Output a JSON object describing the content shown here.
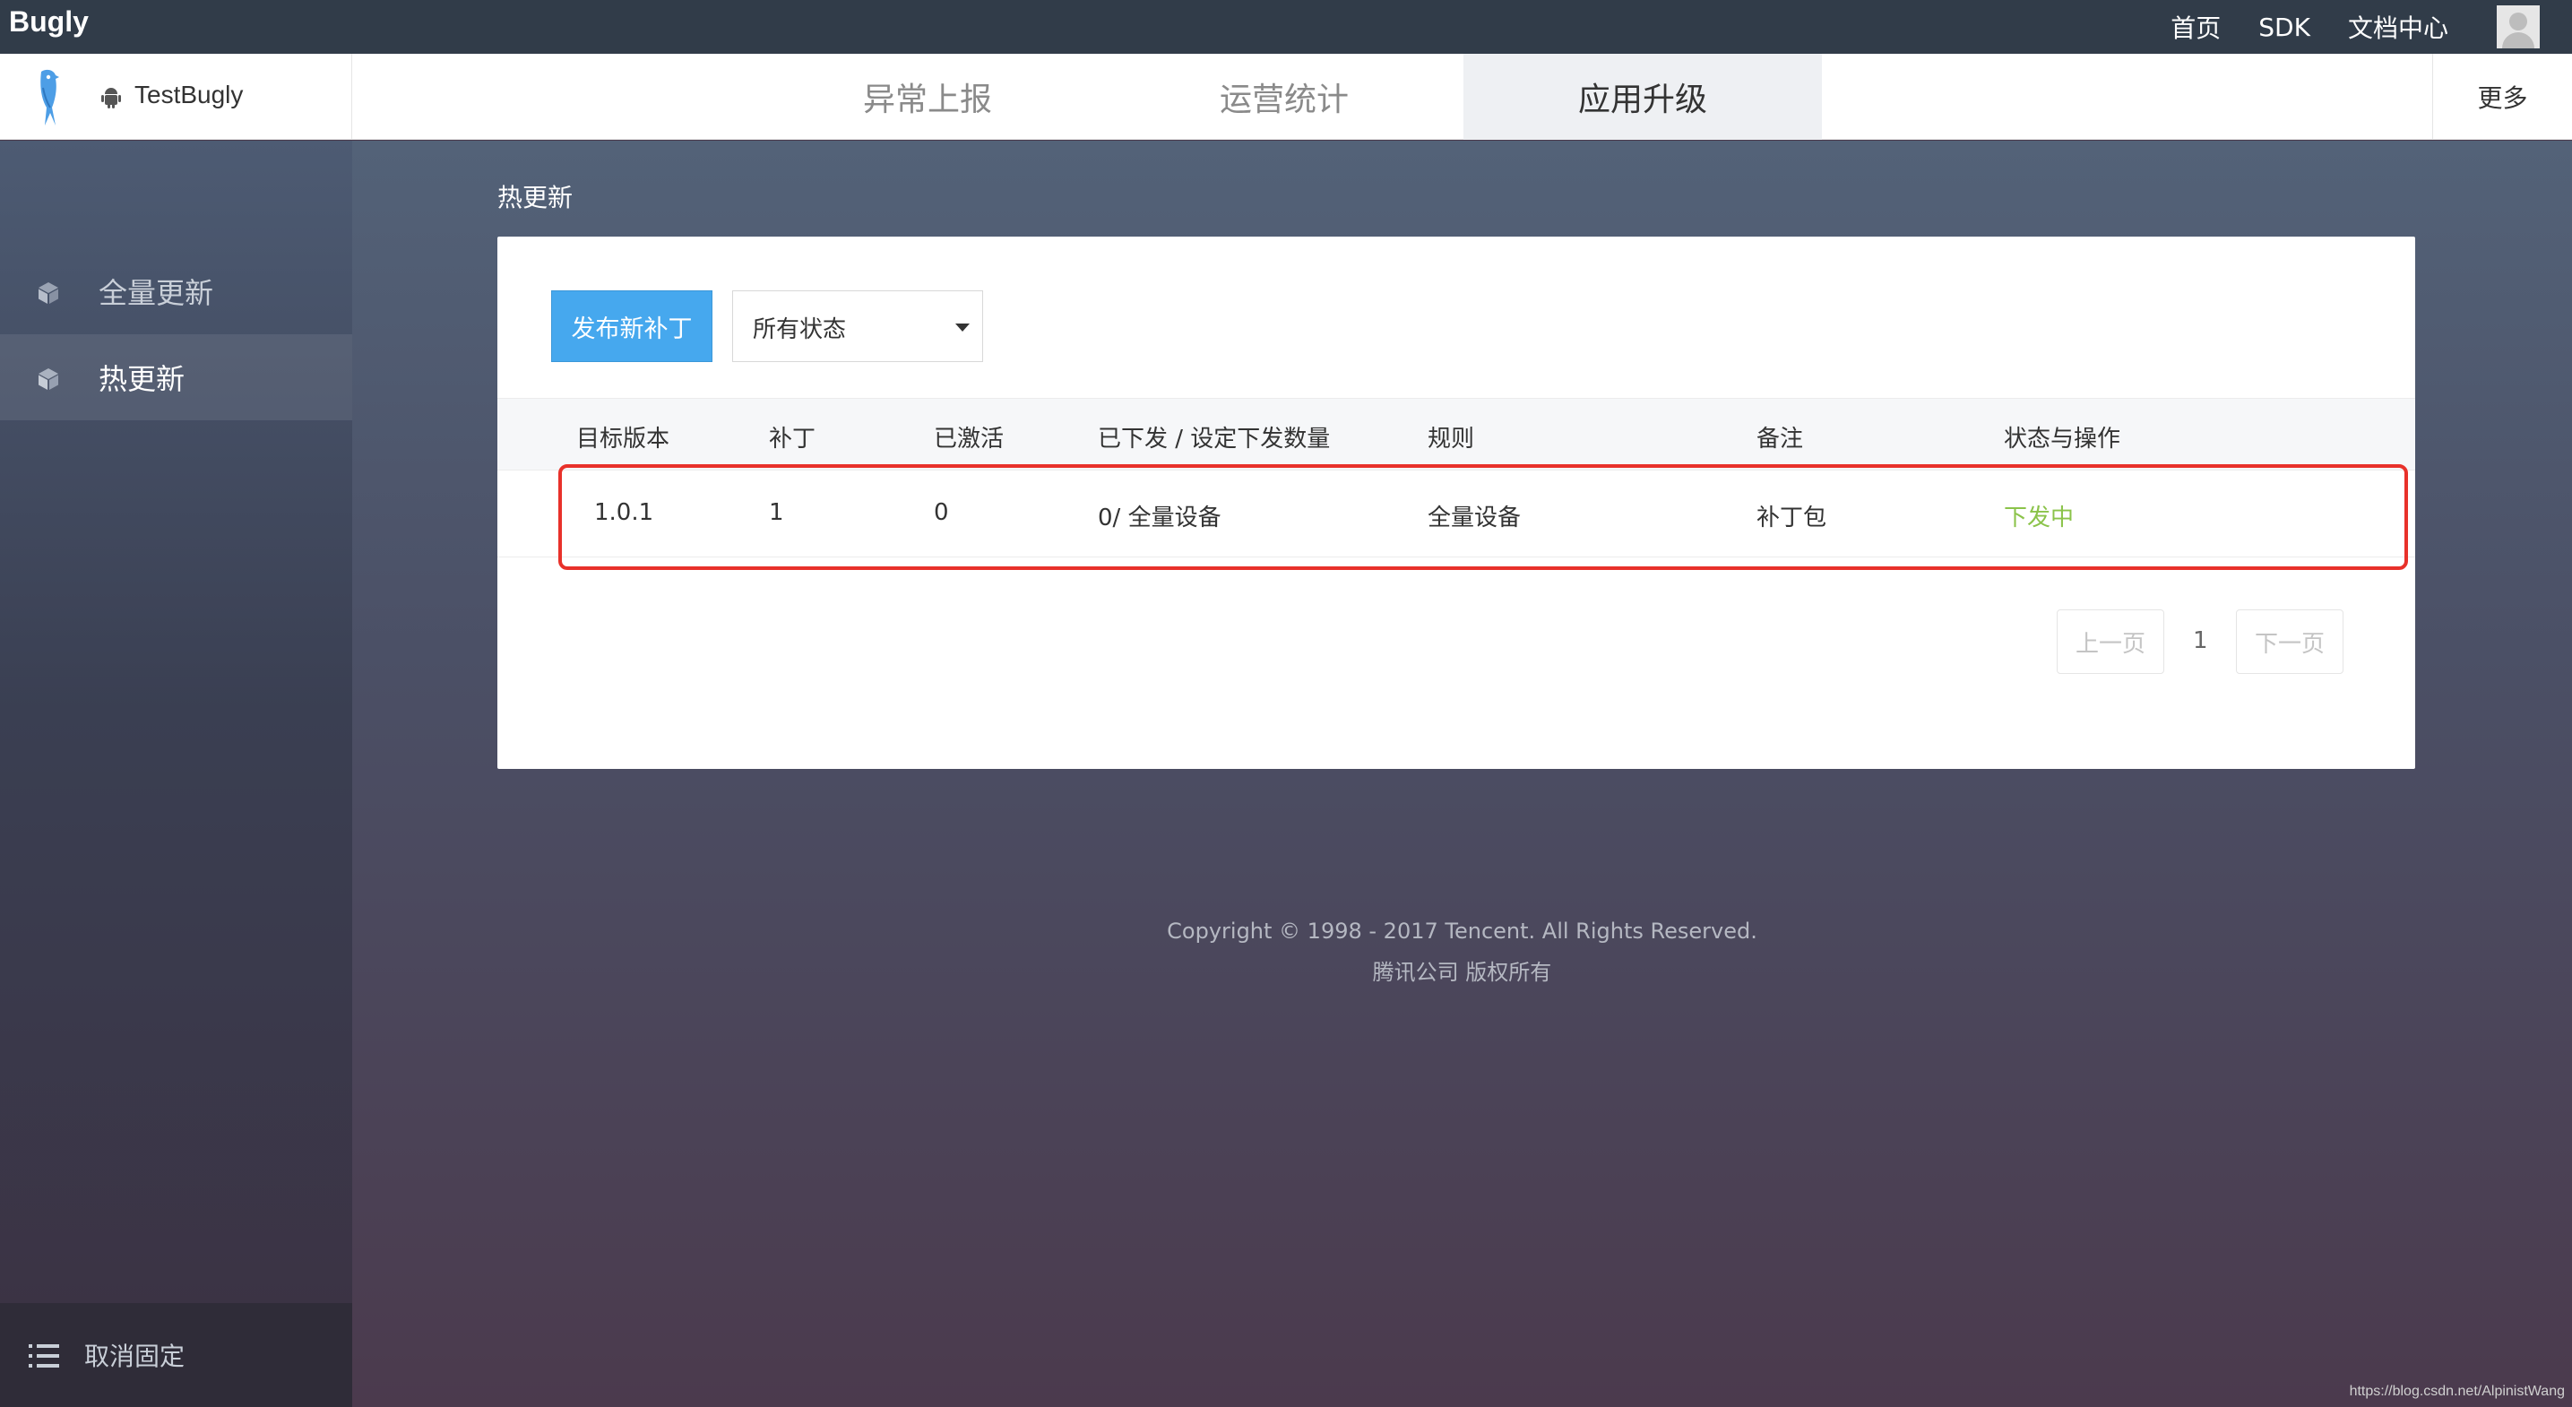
{
  "topbar": {
    "brand": "Bugly",
    "nav": [
      "首页",
      "SDK",
      "文档中心"
    ]
  },
  "appbar": {
    "app_name": "TestBugly",
    "tabs": [
      "异常上报",
      "运营统计",
      "应用升级"
    ],
    "active_tab": "应用升级",
    "more_label": "更多"
  },
  "sidebar": {
    "items": [
      {
        "label": "全量更新",
        "icon": "cube-icon"
      },
      {
        "label": "热更新",
        "icon": "cube-icon"
      }
    ],
    "active_item": "热更新",
    "unpin_label": "取消固定"
  },
  "main": {
    "title": "热更新",
    "publish_button": "发布新补丁",
    "status_filter": {
      "value": "所有状态"
    },
    "table": {
      "columns": [
        "目标版本",
        "补丁",
        "已激活",
        "已下发 / 设定下发数量",
        "规则",
        "备注",
        "状态与操作"
      ],
      "rows": [
        {
          "version": "1.0.1",
          "patch": "1",
          "activated": "0",
          "issued": "0/ 全量设备",
          "rule": "全量设备",
          "note": "补丁包",
          "status": "下发中"
        }
      ]
    },
    "pagination": {
      "prev": "上一页",
      "current": "1",
      "next": "下一页"
    }
  },
  "footer": {
    "copyright": "Copyright © 1998 - 2017 Tencent. All Rights Reserved.",
    "company": "腾讯公司 版权所有"
  },
  "watermark": "https://blog.csdn.net/AlpinistWang",
  "colors": {
    "topbar": "#313c49",
    "primary": "#46a8ee",
    "status_green": "#8bc34a",
    "highlight_red": "#e8312a"
  }
}
